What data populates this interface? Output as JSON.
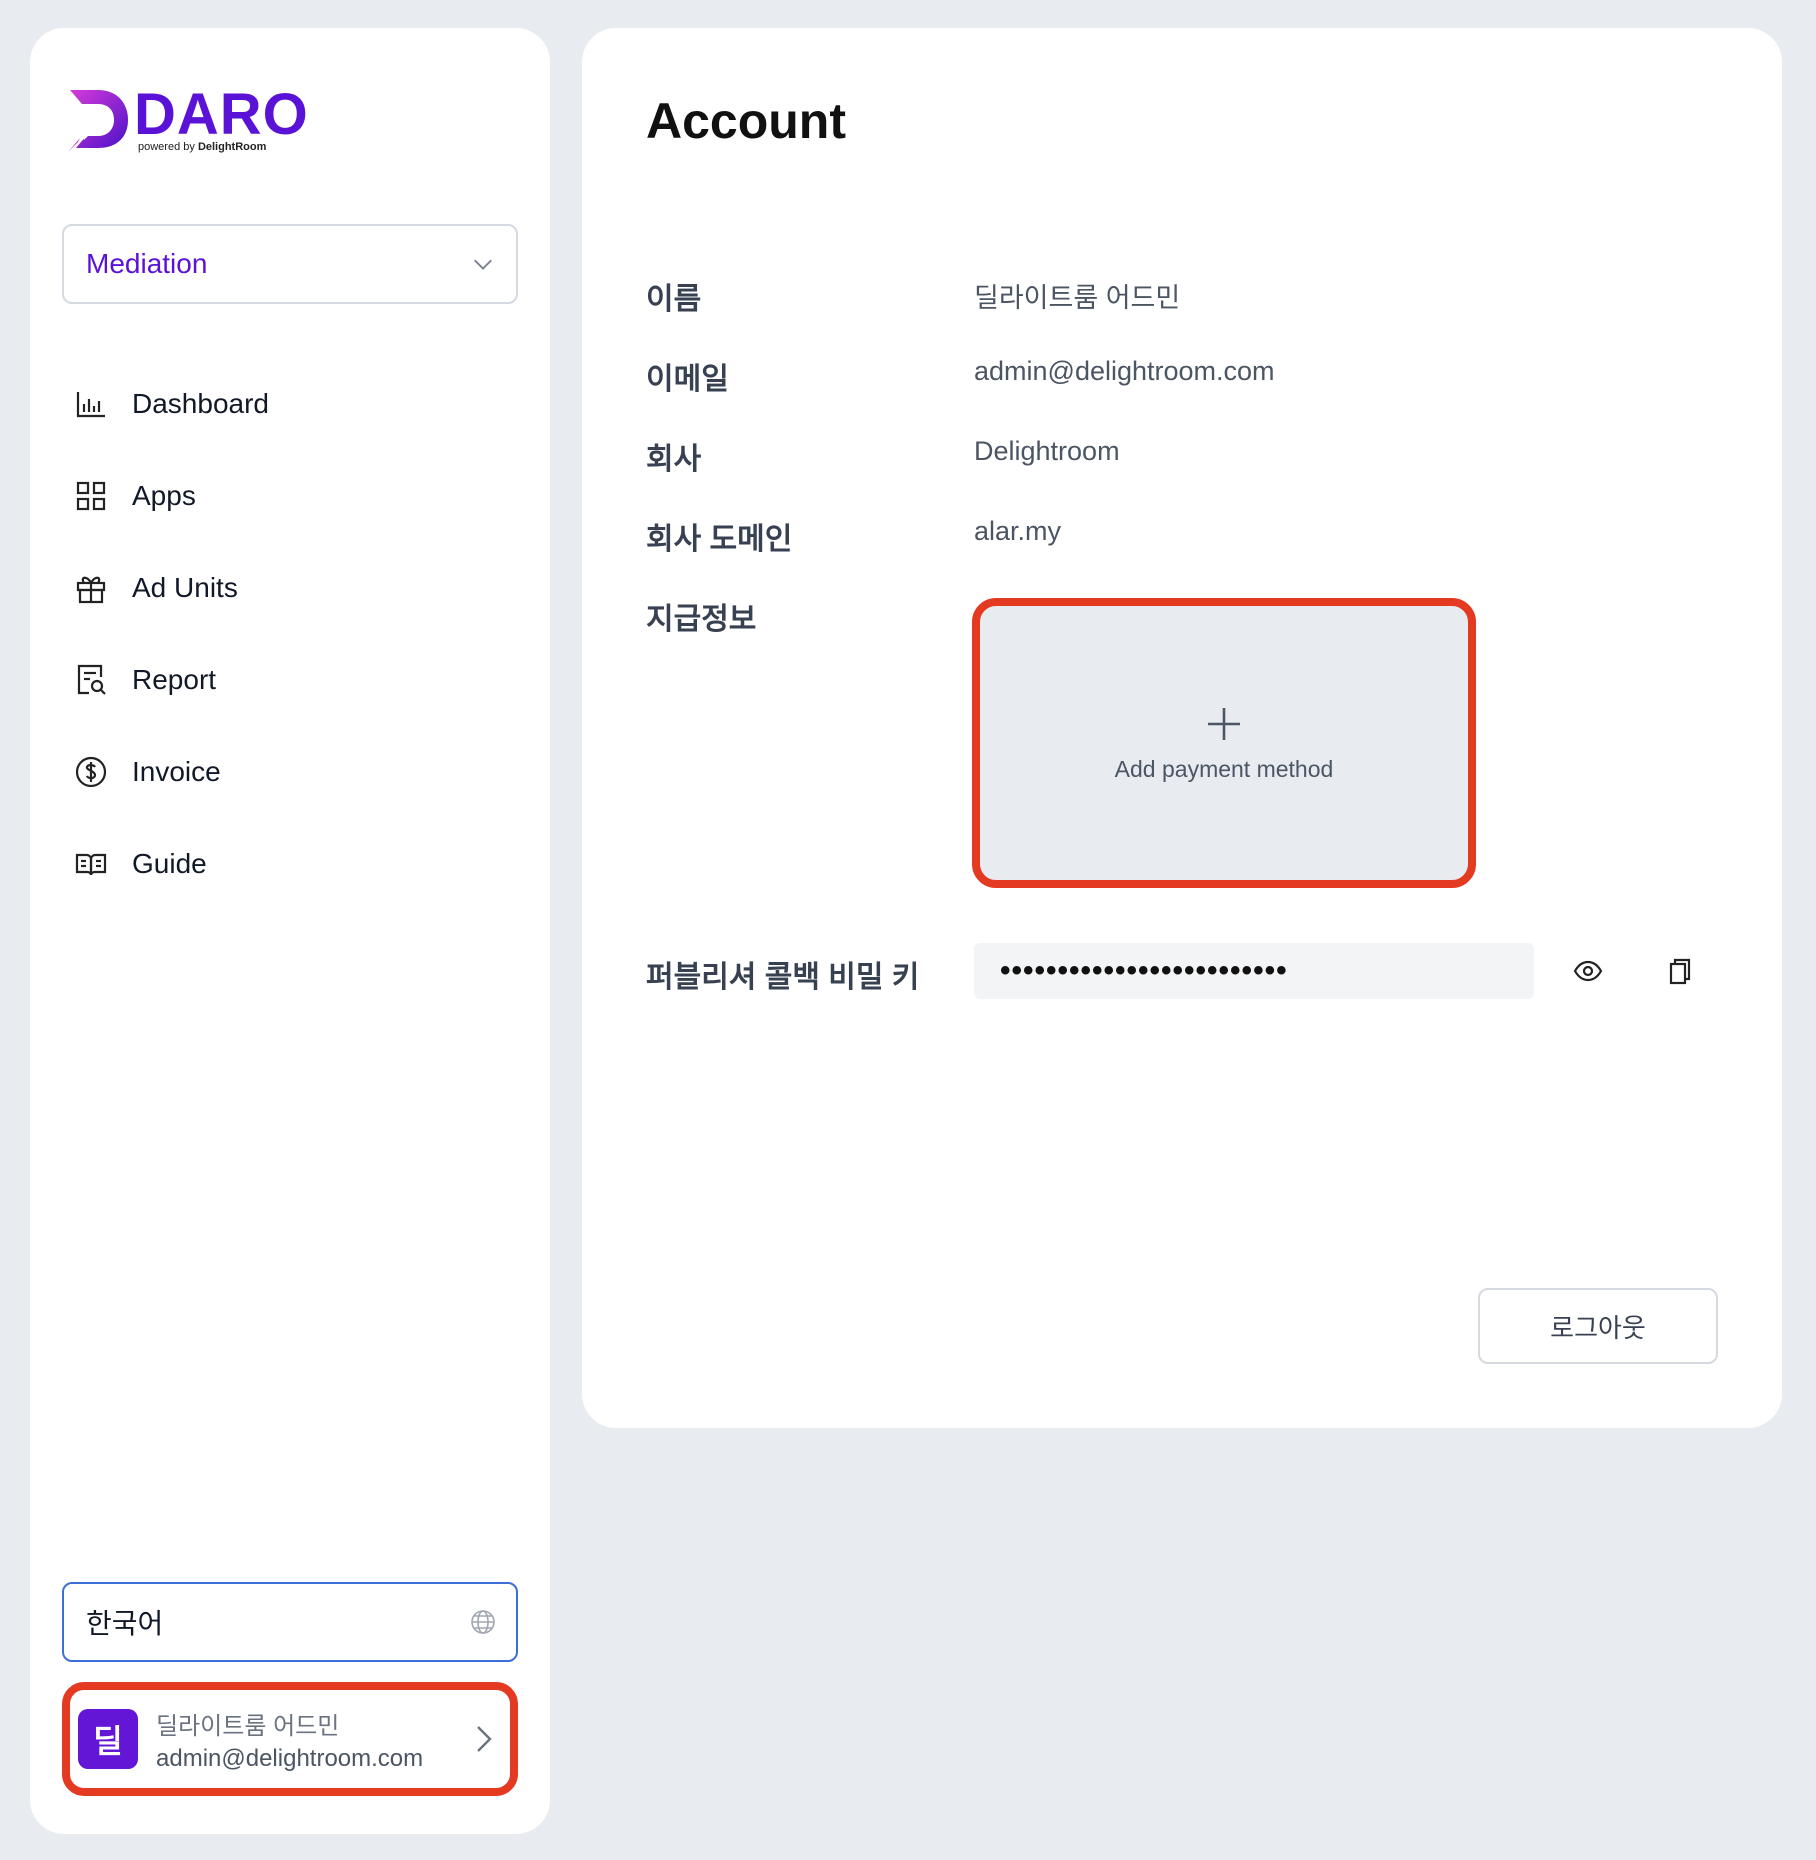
{
  "brand": {
    "name": "DARO",
    "tagline_prefix": "powered by",
    "tagline_company": "DelightRoom",
    "color": "#5a12d6"
  },
  "sidebar": {
    "product_select": {
      "value": "Mediation"
    },
    "items": [
      {
        "label": "Dashboard",
        "icon": "bar-chart-icon"
      },
      {
        "label": "Apps",
        "icon": "grid-icon"
      },
      {
        "label": "Ad Units",
        "icon": "gift-icon"
      },
      {
        "label": "Report",
        "icon": "report-search-icon"
      },
      {
        "label": "Invoice",
        "icon": "dollar-circle-icon"
      },
      {
        "label": "Guide",
        "icon": "open-book-icon"
      }
    ],
    "language": {
      "value": "한국어",
      "icon": "globe-icon"
    },
    "user": {
      "avatar_initial": "딜",
      "name": "딜라이트룸 어드민",
      "email": "admin@delightroom.com"
    }
  },
  "account": {
    "title": "Account",
    "fields": [
      {
        "label": "이름",
        "value": "딜라이트룸 어드민"
      },
      {
        "label": "이메일",
        "value": "admin@delightroom.com"
      },
      {
        "label": "회사",
        "value": "Delightroom"
      },
      {
        "label": "회사 도메인",
        "value": "alar.my"
      }
    ],
    "payment": {
      "label": "지급정보",
      "add_label": "Add payment method"
    },
    "secret": {
      "label": "퍼블리셔 콜백 비밀 키",
      "masked_value": "•••••••••••••••••••••••••"
    },
    "logout_label": "로그아웃"
  },
  "colors": {
    "accent": "#5a12d6",
    "highlight": "#e53a22",
    "focus": "#3d6fd8",
    "background": "#e8ebf0"
  }
}
